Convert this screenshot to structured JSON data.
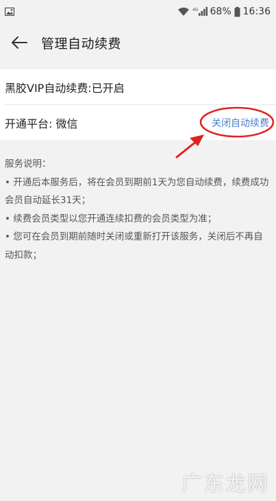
{
  "status_bar": {
    "battery_percent": "68%",
    "time": "16:36",
    "network_label": "4G",
    "icons": [
      "gallery-icon",
      "wifi-icon",
      "signal-icon",
      "battery-icon"
    ]
  },
  "header": {
    "title": "管理自动续费"
  },
  "card": {
    "status_text": "黑胶VIP自动续费:已开启",
    "platform_text": "开通平台: 微信",
    "cancel_label": "关闭自动续费"
  },
  "description": {
    "heading": "服务说明：",
    "items": [
      "• 开通后本服务后，将在会员到期前1天为您自动续费，续费成功会员自动延长31天；",
      "• 续费会员类型以您开通连续扣费的会员类型为准；",
      "• 您可在会员到期前随时关闭或重新打开该服务，关闭后不再自动扣款；"
    ]
  },
  "watermark": {
    "text": "广东龙网"
  },
  "colors": {
    "background": "#f2f2f2",
    "card": "#ffffff",
    "link": "#4a7ed0",
    "annotation_red": "#e02020"
  }
}
